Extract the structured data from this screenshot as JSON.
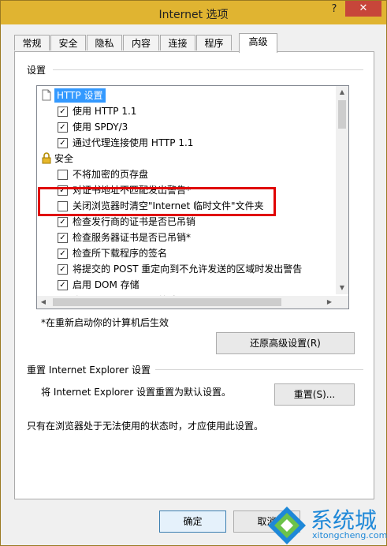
{
  "window": {
    "title": "Internet 选项",
    "help_label": "?",
    "close_label": "✕"
  },
  "tabs": [
    "常规",
    "安全",
    "隐私",
    "内容",
    "连接",
    "程序",
    "高级"
  ],
  "settings_group": {
    "label": "设置"
  },
  "settings_list": [
    {
      "type": "category",
      "icon": "page-icon",
      "label": "HTTP 设置",
      "selected": true
    },
    {
      "type": "option",
      "checked": true,
      "label": "使用 HTTP 1.1"
    },
    {
      "type": "option",
      "checked": true,
      "label": "使用 SPDY/3"
    },
    {
      "type": "option",
      "checked": true,
      "label": "通过代理连接使用 HTTP 1.1"
    },
    {
      "type": "category",
      "icon": "lock-icon",
      "label": "安全"
    },
    {
      "type": "option",
      "checked": false,
      "label": "不将加密的页存盘"
    },
    {
      "type": "option",
      "checked": true,
      "label": "对证书地址不匹配发出警告*"
    },
    {
      "type": "option",
      "checked": false,
      "label": "关闭浏览器时清空\"Internet 临时文件\"文件夹"
    },
    {
      "type": "option",
      "checked": true,
      "label": "检查发行商的证书是否已吊销"
    },
    {
      "type": "option",
      "checked": true,
      "label": "检查服务器证书是否已吊销*"
    },
    {
      "type": "option",
      "checked": true,
      "label": "检查所下载程序的签名"
    },
    {
      "type": "option",
      "checked": true,
      "label": "将提交的 POST 重定向到不允许发送的区域时发出警告"
    },
    {
      "type": "option",
      "checked": true,
      "label": "启用 DOM 存储"
    },
    {
      "type": "option",
      "checked": false,
      "label": "启用 SmartScreen 筛选器"
    }
  ],
  "restart_note": "*在重新启动你的计算机后生效",
  "restore_button": "还原高级设置(R)",
  "reset_group": {
    "label": "重置 Internet Explorer 设置"
  },
  "reset_desc": "将 Internet Explorer 设置重置为默认设置。",
  "reset_button": "重置(S)...",
  "reset_note": "只有在浏览器处于无法使用的状态时，才应使用此设置。",
  "ok_button": "确定",
  "cancel_button": "取消",
  "watermark": {
    "text": "系统城",
    "url": "xitongcheng.com"
  },
  "colors": {
    "titlebar": "#e0b431",
    "close": "#c7463a",
    "highlight": "#3399ff",
    "annotation": "#e00000",
    "watermark": "#1e88d8"
  }
}
